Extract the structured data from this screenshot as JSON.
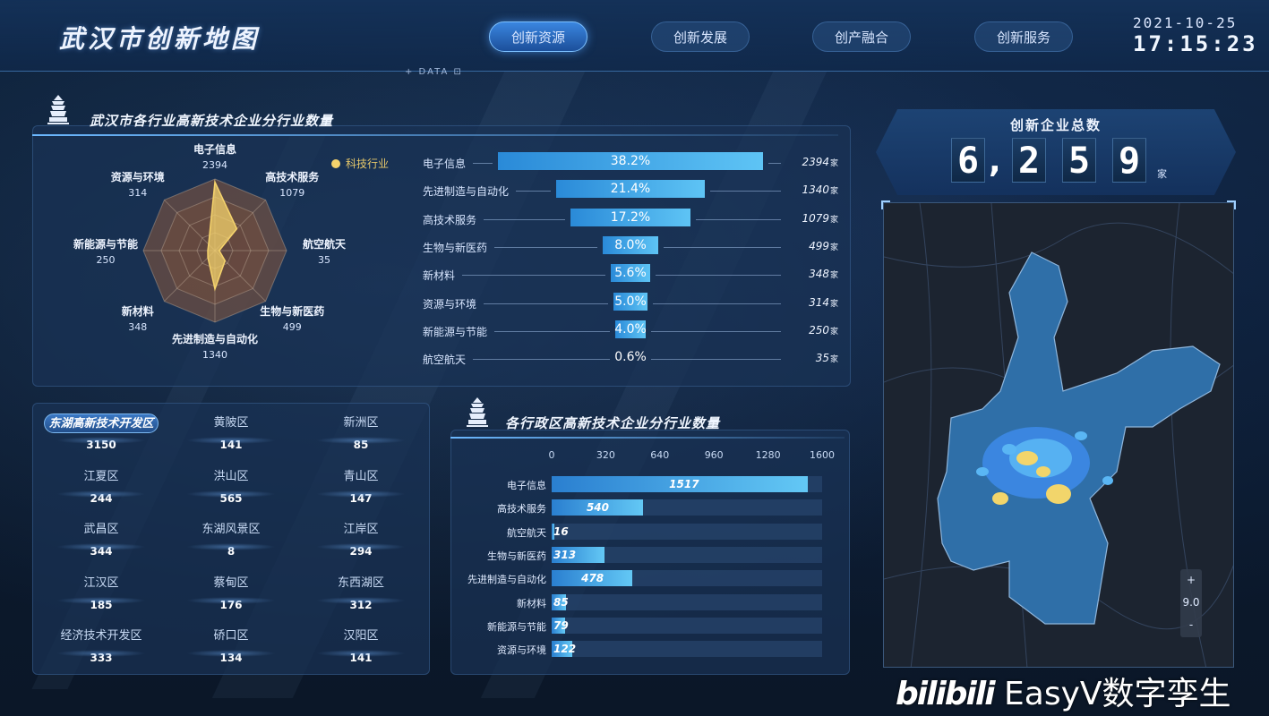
{
  "header": {
    "title": "武汉市创新地图",
    "nav": [
      "创新资源",
      "创新发展",
      "创产融合",
      "创新服务"
    ],
    "active_nav": 0,
    "date": "2021-10-25",
    "time": "17:15:23",
    "data_tag": "+ DATA ⊡"
  },
  "industry_panel": {
    "title": "武汉市各行业高新技术企业分行业数量",
    "legend": "科技行业",
    "radar": [
      {
        "name": "电子信息",
        "value": "2394"
      },
      {
        "name": "高技术服务",
        "value": "1079"
      },
      {
        "name": "航空航天",
        "value": "35"
      },
      {
        "name": "生物与新医药",
        "value": "499"
      },
      {
        "name": "先进制造与自动化",
        "value": "1340"
      },
      {
        "name": "新材料",
        "value": "348"
      },
      {
        "name": "新能源与节能",
        "value": "250"
      },
      {
        "name": "资源与环境",
        "value": "314"
      }
    ],
    "funnel": [
      {
        "name": "电子信息",
        "percent": "38.2%",
        "frac": 0.382,
        "value": "2394"
      },
      {
        "name": "先进制造与自动化",
        "percent": "21.4%",
        "frac": 0.214,
        "value": "1340"
      },
      {
        "name": "高技术服务",
        "percent": "17.2%",
        "frac": 0.172,
        "value": "1079"
      },
      {
        "name": "生物与新医药",
        "percent": "8.0%",
        "frac": 0.08,
        "value": "499"
      },
      {
        "name": "新材料",
        "percent": "5.6%",
        "frac": 0.056,
        "value": "348"
      },
      {
        "name": "资源与环境",
        "percent": "5.0%",
        "frac": 0.05,
        "value": "314"
      },
      {
        "name": "新能源与节能",
        "percent": "4.0%",
        "frac": 0.04,
        "value": "250"
      },
      {
        "name": "航空航天",
        "percent": "0.6%",
        "frac": 0.006,
        "value": "35"
      }
    ],
    "unit": "家"
  },
  "districts": [
    {
      "name": "东湖高新技术开发区",
      "count": "3150"
    },
    {
      "name": "黄陂区",
      "count": "141"
    },
    {
      "name": "新洲区",
      "count": "85"
    },
    {
      "name": "江夏区",
      "count": "244"
    },
    {
      "name": "洪山区",
      "count": "565"
    },
    {
      "name": "青山区",
      "count": "147"
    },
    {
      "name": "武昌区",
      "count": "344"
    },
    {
      "name": "东湖风景区",
      "count": "8"
    },
    {
      "name": "江岸区",
      "count": "294"
    },
    {
      "name": "江汉区",
      "count": "185"
    },
    {
      "name": "蔡甸区",
      "count": "176"
    },
    {
      "name": "东西湖区",
      "count": "312"
    },
    {
      "name": "经济技术开发区",
      "count": "333"
    },
    {
      "name": "硚口区",
      "count": "134"
    },
    {
      "name": "汉阳区",
      "count": "141"
    }
  ],
  "active_district": 0,
  "district_panel": {
    "title": "各行政区高新技术企业分行业数量"
  },
  "chart_data": {
    "type": "bar",
    "orientation": "horizontal",
    "categories": [
      "电子信息",
      "高技术服务",
      "航空航天",
      "生物与新医药",
      "先进制造与自动化",
      "新材料",
      "新能源与节能",
      "资源与环境"
    ],
    "values": [
      1517,
      540,
      16,
      313,
      478,
      85,
      79,
      122
    ],
    "xlim": [
      0,
      1600
    ],
    "ticks": [
      "0",
      "320",
      "640",
      "960",
      "1280",
      "1600"
    ],
    "title": "各行政区高新技术企业分行业数量",
    "xlabel": "",
    "ylabel": ""
  },
  "total": {
    "title": "创新企业总数",
    "digits": [
      "6",
      "2",
      "5",
      "9"
    ],
    "unit": "家"
  },
  "map": {
    "zoom_in": "+",
    "zoom_level": "9.0",
    "zoom_out": "-"
  },
  "watermark": {
    "brand": "bilibili",
    "text": "EasyV数字孪生"
  },
  "colors": {
    "accent": "#3a86e0",
    "bar": "#5ec4f5",
    "radar_fill": "#f5d36c",
    "heat_hot": "#f2d56b"
  }
}
